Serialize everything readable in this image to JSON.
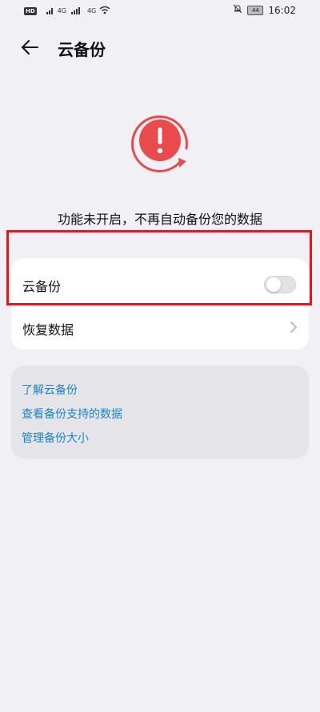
{
  "status_bar": {
    "hd_label": "HD",
    "signal1_label": "4G",
    "signal2_label": "4G",
    "battery_level": "44",
    "time": "16:02"
  },
  "header": {
    "title": "云备份"
  },
  "status_message": "功能未开启，不再自动备份您的数据",
  "settings": {
    "cloud_backup_label": "云备份",
    "cloud_backup_enabled": false,
    "restore_label": "恢复数据"
  },
  "links": [
    "了解云备份",
    "查看备份支持的数据",
    "管理备份大小"
  ],
  "colors": {
    "alert": "#ea4a4c",
    "link": "#1a87c7",
    "highlight": "#e8141c"
  }
}
